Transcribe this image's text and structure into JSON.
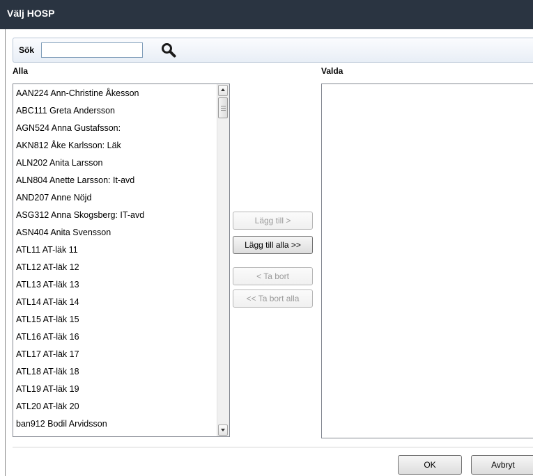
{
  "window": {
    "title": "Välj HOSP"
  },
  "search": {
    "label": "Sök",
    "value": "",
    "placeholder": ""
  },
  "available": {
    "header": "Alla",
    "items": [
      "AAN224 Ann-Christine Åkesson",
      "ABC111 Greta Andersson",
      "AGN524 Anna Gustafsson:",
      "AKN812 Åke Karlsson: Läk",
      "ALN202 Anita Larsson",
      "ALN804 Anette Larsson: It-avd",
      "AND207 Anne Nöjd",
      "ASG312 Anna Skogsberg: IT-avd",
      "ASN404 Anita Svensson",
      "ATL11 AT-läk 11",
      "ATL12 AT-läk 12",
      "ATL13 AT-läk 13",
      "ATL14 AT-läk 14",
      "ATL15 AT-läk 15",
      "ATL16 AT-läk 16",
      "ATL17 AT-läk 17",
      "ATL18 AT-läk 18",
      "ATL19 AT-läk 19",
      "ATL20 AT-läk 20",
      "ban912 Bodil Arvidsson"
    ]
  },
  "selected": {
    "header": "Valda",
    "items": []
  },
  "move_buttons": {
    "add": "Lägg till >",
    "add_all": "Lägg till alla >>",
    "remove": "< Ta bort",
    "remove_all": "<< Ta bort alla"
  },
  "dialog_buttons": {
    "ok": "OK",
    "cancel": "Avbryt"
  },
  "icons": {
    "search": "search-icon"
  },
  "colors": {
    "titlebar": "#2a3441",
    "disabled_text": "#9a9a9a"
  }
}
